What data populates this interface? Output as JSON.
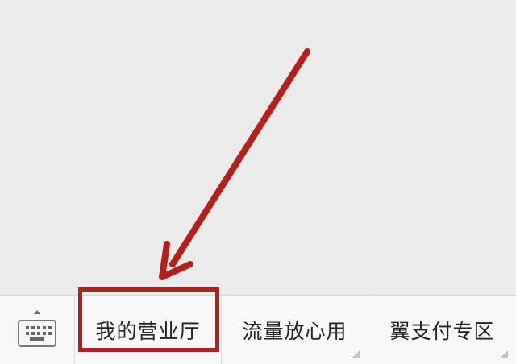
{
  "menu_bar": {
    "keyboard_toggle_icon": "keyboard-icon",
    "items": [
      {
        "label": "我的营业厅",
        "has_submenu": false
      },
      {
        "label": "流量放心用",
        "has_submenu": true
      },
      {
        "label": "翼支付专区",
        "has_submenu": true
      }
    ]
  },
  "annotation": {
    "color": "#b5201c",
    "arrow": "arrow-pointing-to-first-item"
  }
}
